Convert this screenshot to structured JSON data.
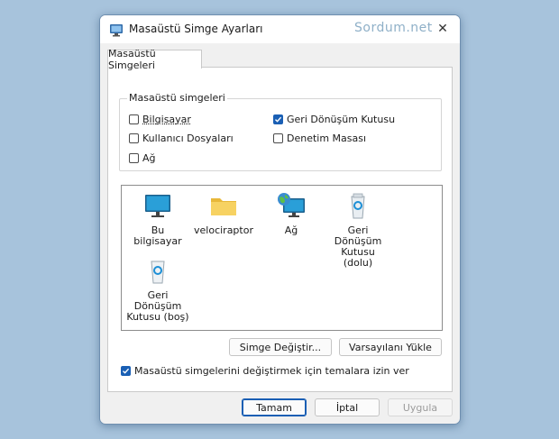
{
  "window": {
    "title": "Masaüstü Simge Ayarları",
    "watermark": "Sordum.net",
    "close_glyph": "✕"
  },
  "tabs": [
    {
      "label": "Masaüstü Simgeleri",
      "active": true
    }
  ],
  "icons_group": {
    "legend": "Masaüstü simgeleri",
    "checkboxes": [
      {
        "label": "Bilgisayar",
        "checked": false
      },
      {
        "label": "Geri Dönüşüm Kutusu",
        "checked": true
      },
      {
        "label": "Kullanıcı Dosyaları",
        "checked": false
      },
      {
        "label": "Denetim Masası",
        "checked": false
      },
      {
        "label": "Ağ",
        "checked": false
      }
    ]
  },
  "icon_list": [
    {
      "label": "Bu bilgisayar",
      "icon": "monitor-icon"
    },
    {
      "label": "velociraptor",
      "icon": "folder-icon"
    },
    {
      "label": "Ağ",
      "icon": "network-globe-icon"
    },
    {
      "label": "Geri Dönüşüm Kutusu (dolu)",
      "icon": "recycle-bin-full-icon"
    },
    {
      "label": "Geri Dönüşüm Kutusu (boş)",
      "icon": "recycle-bin-empty-icon"
    }
  ],
  "buttons": {
    "change_icon": "Simge Değiştir...",
    "restore_default": "Varsayılanı Yükle",
    "ok": "Tamam",
    "cancel": "İptal",
    "apply": "Uygula"
  },
  "allow_themes": {
    "label": "Masaüstü simgelerini değiştirmek için temalara izin ver",
    "checked": true
  },
  "colors": {
    "accent": "#1a5fb4",
    "desktop_background": "#a7c3dc"
  }
}
